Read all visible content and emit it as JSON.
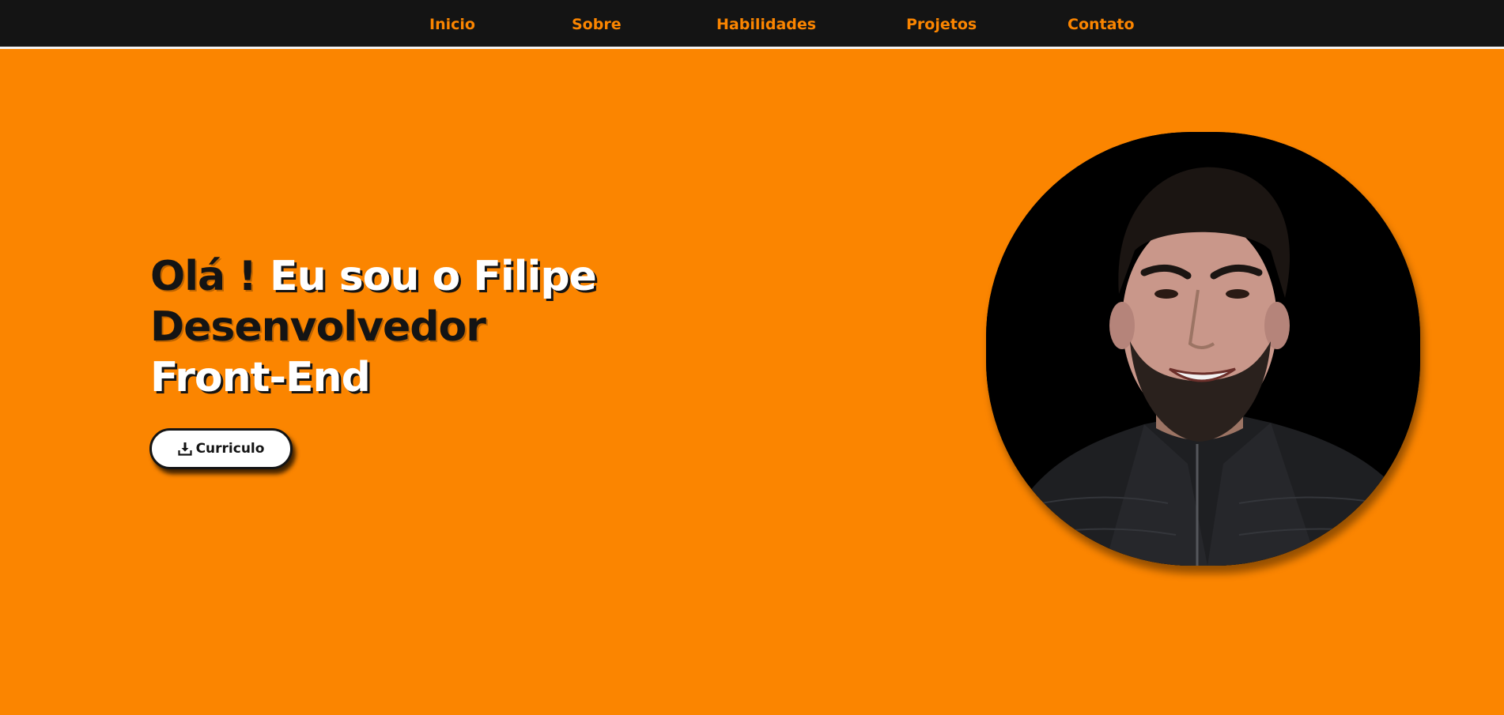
{
  "nav": {
    "items": [
      {
        "label": "Inicio"
      },
      {
        "label": "Sobre"
      },
      {
        "label": "Habilidades"
      },
      {
        "label": "Projetos"
      },
      {
        "label": "Contato"
      }
    ]
  },
  "hero": {
    "greeting": "Olá !",
    "intro": "Eu sou o Filipe",
    "role_line1": "Desenvolvedor",
    "role_line2": "Front-End",
    "resume_button_label": "Curriculo",
    "resume_icon": "download-icon",
    "photo": "profile-photo"
  },
  "colors": {
    "background": "#fb8500",
    "nav_background": "#141414",
    "accent_text": "#fb8500",
    "dark_text": "#141414",
    "light_text": "#ffffff"
  }
}
